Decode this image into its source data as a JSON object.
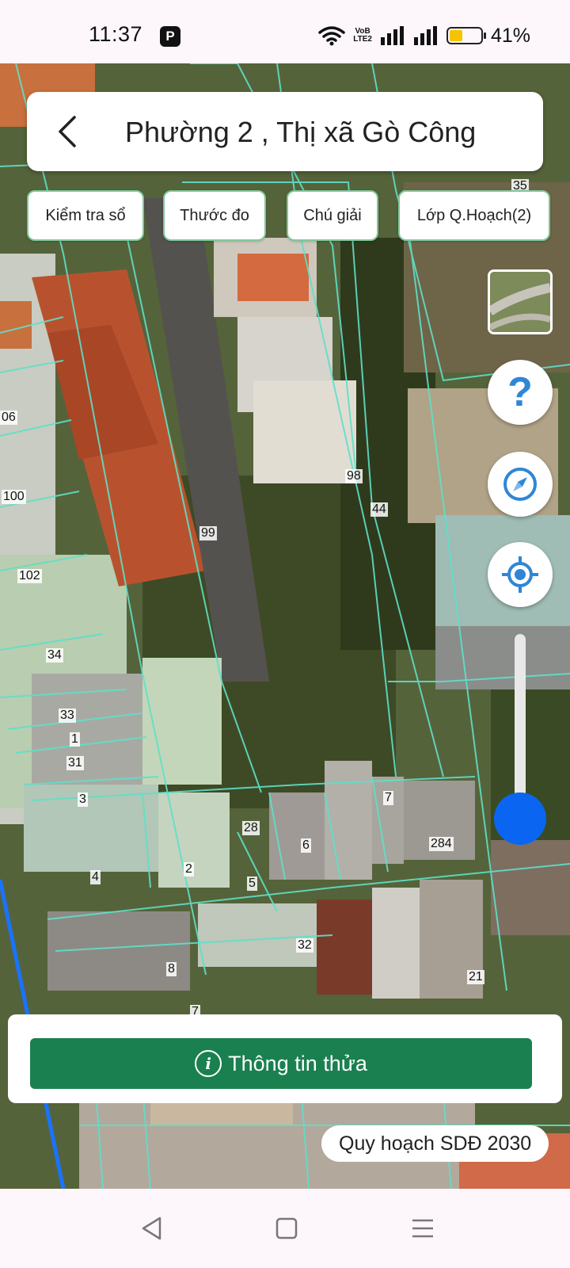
{
  "status_bar": {
    "time": "11:37",
    "app_icon": "P",
    "volte": "VoB",
    "lte": "LTE2",
    "battery_level": 0.41,
    "battery_text": "41%"
  },
  "header": {
    "title": "Phường 2 , Thị xã Gò Công",
    "back_icon": "chevron-left-icon"
  },
  "toolbar": {
    "buttons": [
      "Kiểm tra sổ",
      "Thước đo",
      "Chú giải",
      "Lớp Q.Hoạch(2)"
    ]
  },
  "map": {
    "parcel_labels": [
      "35",
      "06",
      "100",
      "102",
      "99",
      "98",
      "44",
      "34",
      "33",
      "1",
      "31",
      "3",
      "28",
      "6",
      "7",
      "284",
      "4",
      "2",
      "5",
      "32",
      "8",
      "21",
      "7"
    ],
    "zoom_level": 0.2
  },
  "controls": {
    "layer_icon": "map-layer-thumbnail-icon",
    "help_label": "?",
    "compass_icon": "compass-icon",
    "locate_icon": "my-location-icon"
  },
  "info_panel": {
    "button_label": "Thông tin thửa",
    "icon": "info-icon",
    "button_color": "#1a8050"
  },
  "plan_label": "Quy hoạch SDĐ 2030",
  "colors": {
    "accent_blue": "#0a66f0",
    "parcel_line": "#5fe0c8",
    "chip_border": "#7fc79a"
  }
}
